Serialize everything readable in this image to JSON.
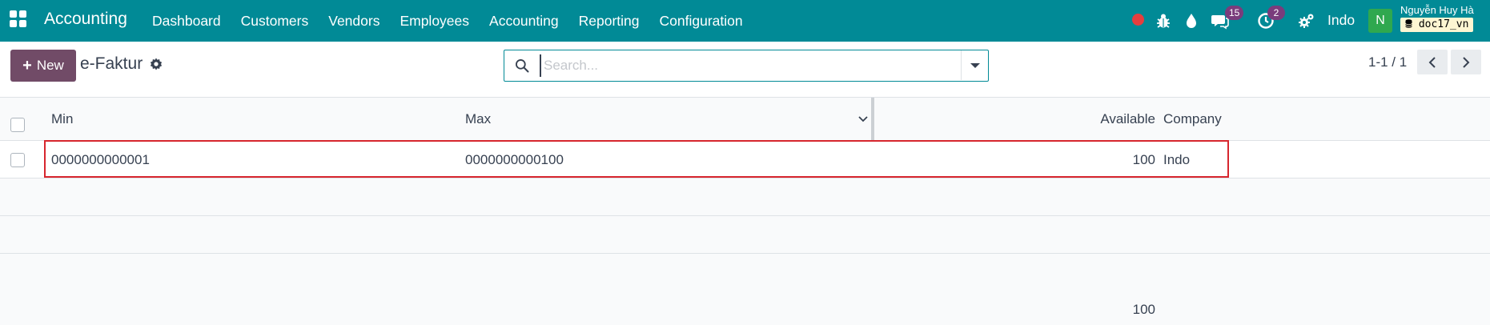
{
  "navbar": {
    "app_name": "Accounting",
    "menu": [
      "Dashboard",
      "Customers",
      "Vendors",
      "Employees",
      "Accounting",
      "Reporting",
      "Configuration"
    ],
    "messages_count": "15",
    "activities_count": "2",
    "company": "Indo",
    "avatar_letter": "N",
    "user_name": "Nguyễn Huy Hà",
    "database": "doc17_vn",
    "icons": [
      "apps-grid-icon",
      "record-dot-icon",
      "bug-icon",
      "droplet-icon",
      "chat-icon",
      "clock-icon",
      "settings-gears-icon"
    ]
  },
  "control": {
    "new_label": "New",
    "breadcrumb": "e-Faktur",
    "search_placeholder": "Search...",
    "pager": "1-1 / 1"
  },
  "table": {
    "columns": [
      "Min",
      "Max",
      "Available",
      "Company"
    ],
    "rows": [
      {
        "min": "0000000000001",
        "max": "0000000000100",
        "available": "100",
        "company": "Indo"
      }
    ],
    "total_available": "100"
  },
  "colors": {
    "navbar": "#018a96",
    "primary_button": "#714b67",
    "badge": "#7a3c7c",
    "highlight": "#d7262e"
  }
}
